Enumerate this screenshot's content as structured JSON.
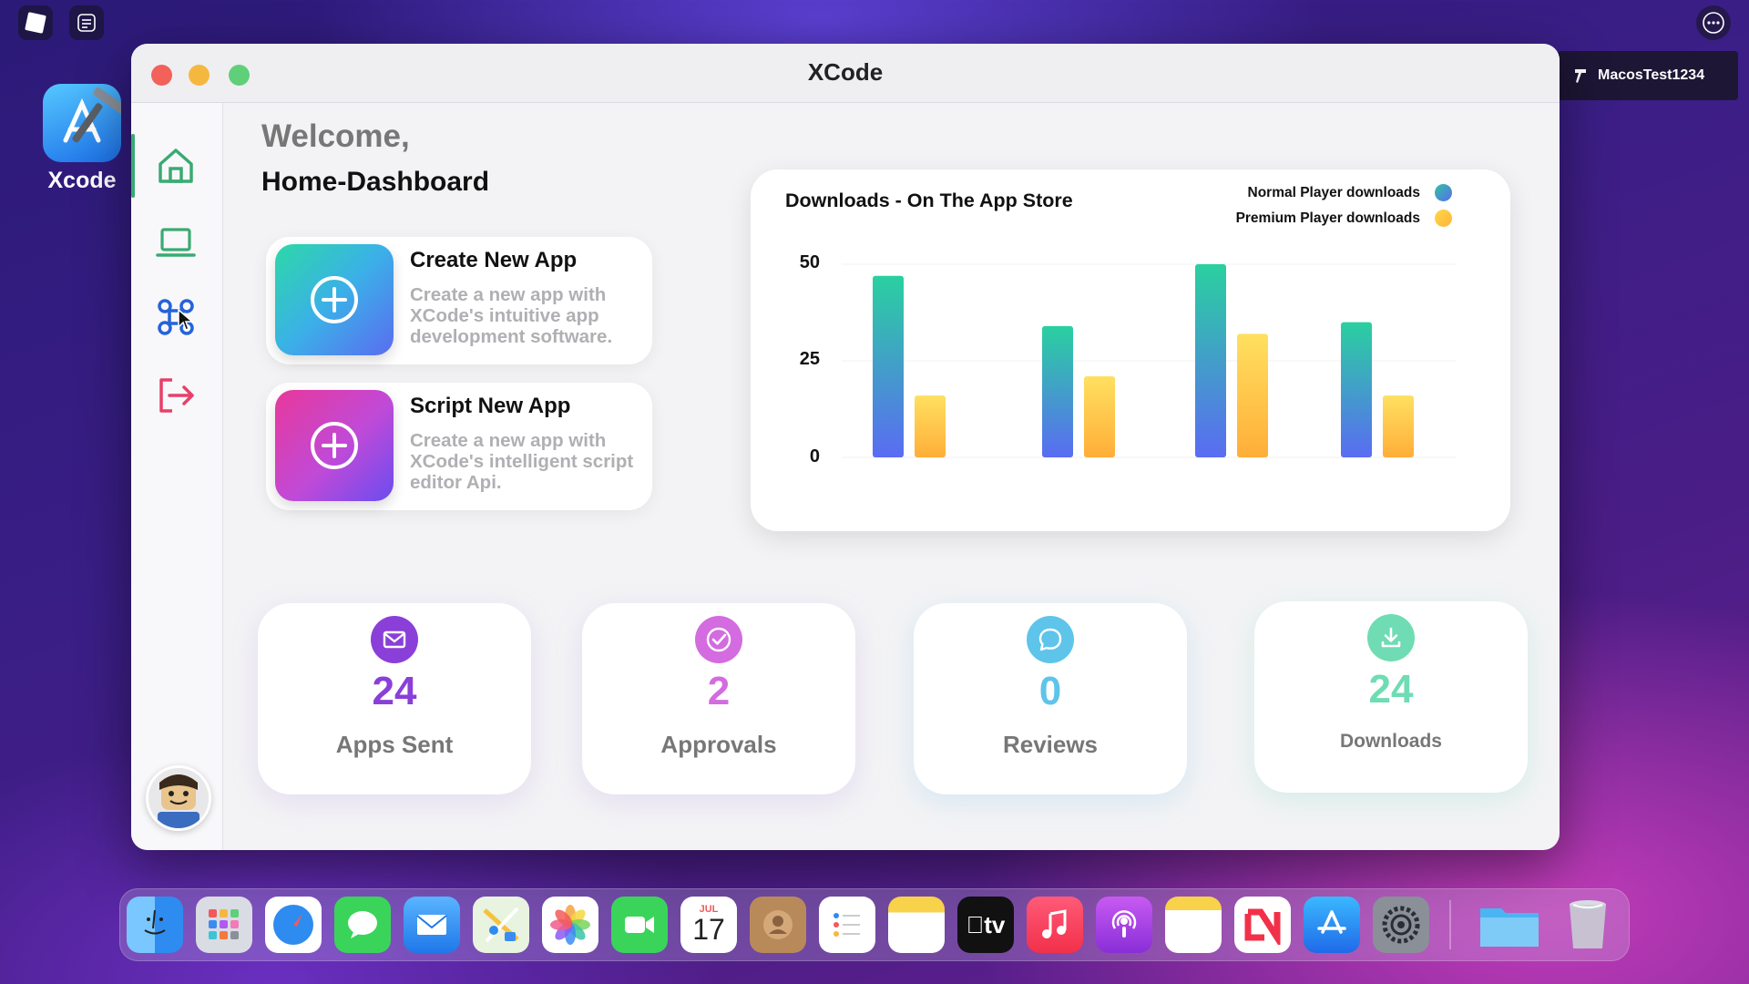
{
  "desktop": {
    "app_icon_label": "Xcode",
    "user_name": "MacosTest1234"
  },
  "window": {
    "title": "XCode",
    "traffic_colors": {
      "close": "#f2615a",
      "minimize": "#f5b83f",
      "maximize": "#5fcf7a"
    }
  },
  "sidebar": {
    "items": [
      {
        "name": "home-icon",
        "active": true
      },
      {
        "name": "laptop-icon",
        "active": false
      },
      {
        "name": "command-icon",
        "active": false
      },
      {
        "name": "logout-icon",
        "active": false
      }
    ]
  },
  "header": {
    "welcome": "Welcome,",
    "subtitle": "Home-Dashboard"
  },
  "actions": [
    {
      "title": "Create New App",
      "description": "Create a new app with XCode's intuitive app development software."
    },
    {
      "title": "Script New App",
      "description": "Create a new app with XCode's intelligent script editor Api."
    }
  ],
  "chart_data": {
    "type": "bar",
    "title": "Downloads - On The App Store",
    "xlabel": "",
    "ylabel": "",
    "ylim": [
      0,
      50
    ],
    "yticks": [
      "50",
      "25",
      "0"
    ],
    "categories": [
      "",
      "",
      "",
      ""
    ],
    "series": [
      {
        "name": "Normal Player downloads",
        "values": [
          47,
          34,
          50,
          35
        ],
        "color": "#2ec4a0"
      },
      {
        "name": "Premium Player downloads",
        "values": [
          16,
          21,
          32,
          16
        ],
        "color": "#ffc93c"
      }
    ],
    "legend_position": "top-right",
    "grid": true
  },
  "stats": [
    {
      "value": "24",
      "label": "Apps Sent",
      "icon": "mail-icon",
      "color": "#8a3fd8"
    },
    {
      "value": "2",
      "label": "Approvals",
      "icon": "check-circle-icon",
      "color": "#d46be0"
    },
    {
      "value": "0",
      "label": "Reviews",
      "icon": "chat-icon",
      "color": "#5ec4ea"
    },
    {
      "value": "24",
      "label": "Downloads",
      "icon": "download-icon",
      "color": "#6fdcb4"
    }
  ],
  "dock": {
    "calendar_month": "JUL",
    "calendar_day": "17",
    "tv_label": "tv",
    "apps": [
      "finder-icon",
      "launchpad-icon",
      "safari-icon",
      "messages-icon",
      "mail-icon",
      "maps-icon",
      "photos-icon",
      "facetime-icon",
      "calendar-icon",
      "contacts-icon",
      "reminders-icon",
      "notes-icon",
      "appletv-icon",
      "music-icon",
      "podcasts-icon",
      "notes-yellow-icon",
      "news-icon",
      "appstore-icon",
      "settings-icon",
      "folder-icon",
      "trash-icon"
    ]
  }
}
